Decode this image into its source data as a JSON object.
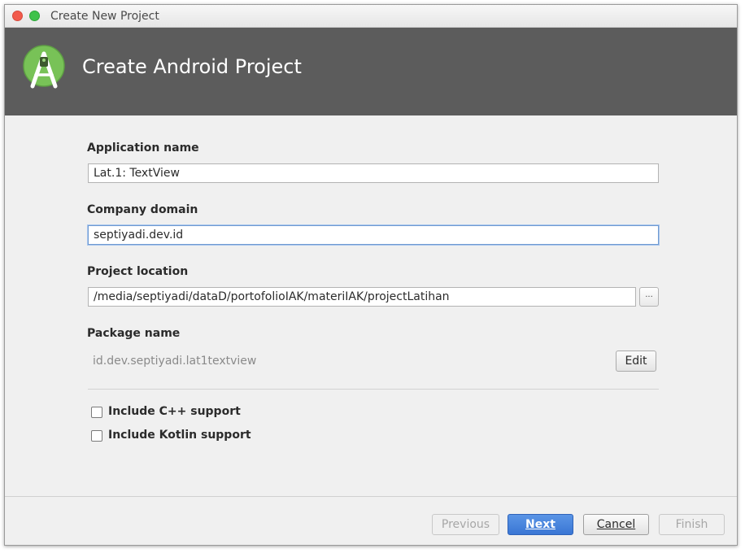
{
  "window": {
    "title": "Create New Project"
  },
  "header": {
    "title": "Create Android Project",
    "logo_icon": "android-studio-icon",
    "accent_color": "#5c5c5c"
  },
  "form": {
    "application_name": {
      "label": "Application name",
      "value": "Lat.1: TextView"
    },
    "company_domain": {
      "label": "Company domain",
      "value": "septiyadi.dev.id"
    },
    "project_location": {
      "label": "Project location",
      "value": "/media/septiyadi/dataD/portofolioIAK/materiIAK/projectLatihan",
      "browse_label": "..."
    },
    "package_name": {
      "label": "Package name",
      "value": "id.dev.septiyadi.lat1textview",
      "edit_label": "Edit"
    },
    "options": [
      {
        "label": "Include C++ support",
        "checked": false
      },
      {
        "label": "Include Kotlin support",
        "checked": false
      }
    ]
  },
  "footer": {
    "previous_label": "Previous",
    "next_label": "Next",
    "cancel_label": "Cancel",
    "finish_label": "Finish",
    "primary_color": "#3a76d4"
  }
}
